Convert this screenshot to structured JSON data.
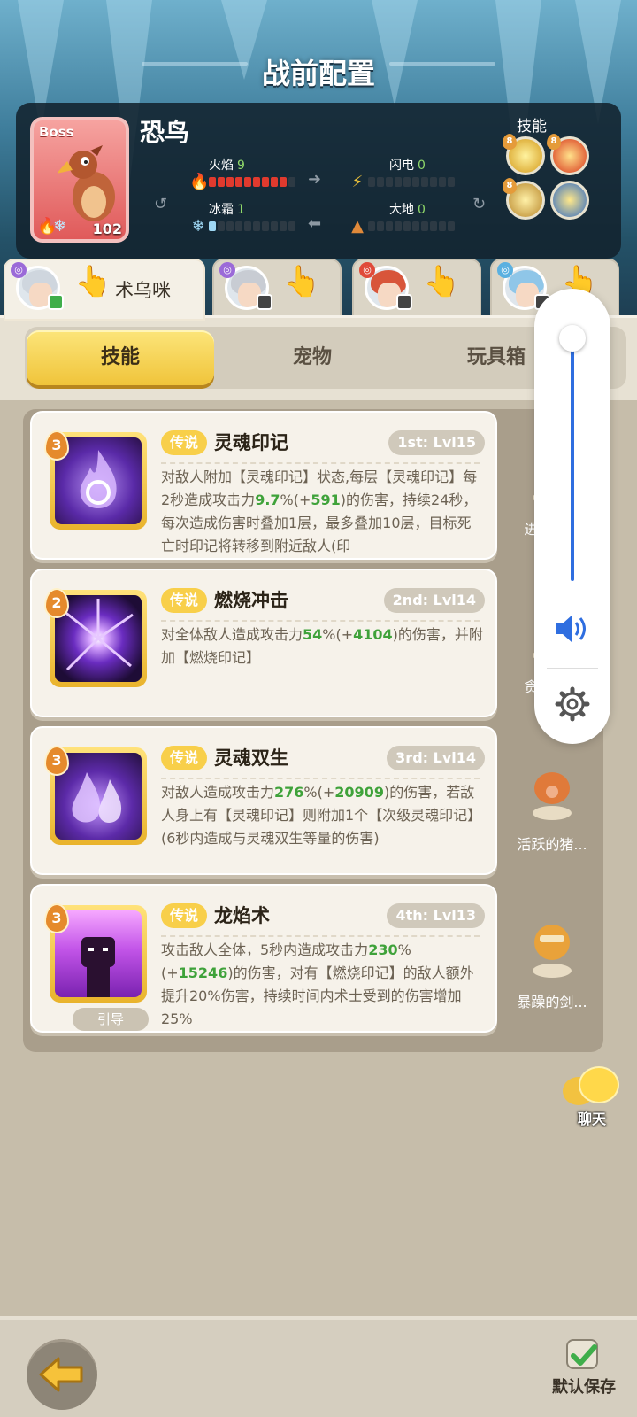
{
  "header": {
    "title": "战前配置"
  },
  "boss": {
    "badge": "Boss",
    "name": "恐鸟",
    "level": "102",
    "stats": [
      {
        "label": "火焰",
        "value": "9",
        "filled": 9,
        "max": 10,
        "color": "#e03a2e"
      },
      {
        "label": "闪电",
        "value": "0",
        "filled": 0,
        "max": 10,
        "color": "#f2c53a"
      },
      {
        "label": "冰霜",
        "value": "1",
        "filled": 1,
        "max": 10,
        "color": "#9fd8f5"
      },
      {
        "label": "大地",
        "value": "0",
        "filled": 0,
        "max": 10,
        "color": "#e0893a"
      }
    ],
    "skills_label": "技能",
    "skill_icons": [
      "lightning-orb-icon",
      "fire-orb-icon",
      "earth-orb-icon",
      "ice-orb-icon"
    ]
  },
  "hero_tabs": [
    {
      "name": "术乌咪",
      "active": true
    },
    {
      "name": "",
      "active": false
    },
    {
      "name": "",
      "active": false
    },
    {
      "name": "",
      "active": false
    }
  ],
  "segments": [
    "技能",
    "宠物",
    "玩具箱"
  ],
  "skills": [
    {
      "rank": "3",
      "tag": "传说",
      "name": "灵魂印记",
      "slot": "1st: Lvl15",
      "desc_parts": [
        "对敌人附加【灵魂印记】状态,每层【灵魂印记】每2秒造成攻击力",
        "9.7",
        "%(+",
        "591",
        ")的伤害，持续24秒，每次造成伤害时叠加1层，最多叠加10层，目标死亡时印记将转移到附近敌人(印",
        "",
        "",
        "",
        ""
      ]
    },
    {
      "rank": "2",
      "tag": "传说",
      "name": "燃烧冲击",
      "slot": "2nd: Lvl14",
      "desc_parts": [
        "对全体敌人造成攻击力",
        "54",
        "%(+",
        "4104",
        ")的伤害，并附加【燃烧印记】",
        "",
        "",
        "",
        ""
      ]
    },
    {
      "rank": "3",
      "tag": "传说",
      "name": "灵魂双生",
      "slot": "3rd: Lvl14",
      "desc_parts": [
        "对敌人造成攻击力",
        "276",
        "%(+",
        "20909",
        ")的伤害，若敌人身上有【灵魂印记】则附加1个【次级灵魂印记】(6秒内造成与灵魂双生等量的伤害)",
        "",
        "",
        "",
        ""
      ]
    },
    {
      "rank": "3",
      "tag": "传说",
      "name": "龙焰术",
      "slot": "4th: Lvl13",
      "desc_parts": [
        "攻击敌人全体，5秒内造成攻击力",
        "230",
        "%(+",
        "15246",
        ")的伤害，对有【燃烧印记】的敌人额外提升20%伤害，持续时间内术士受到的伤害增加25%",
        "",
        "",
        "",
        ""
      ],
      "guide": "引导"
    }
  ],
  "pets": [
    "进击的...",
    "贪吃的...",
    "活跃的猪...",
    "暴躁的剑..."
  ],
  "chat_label": "聊天",
  "save_label": "默认保存",
  "volume": {
    "level": 0.98
  }
}
